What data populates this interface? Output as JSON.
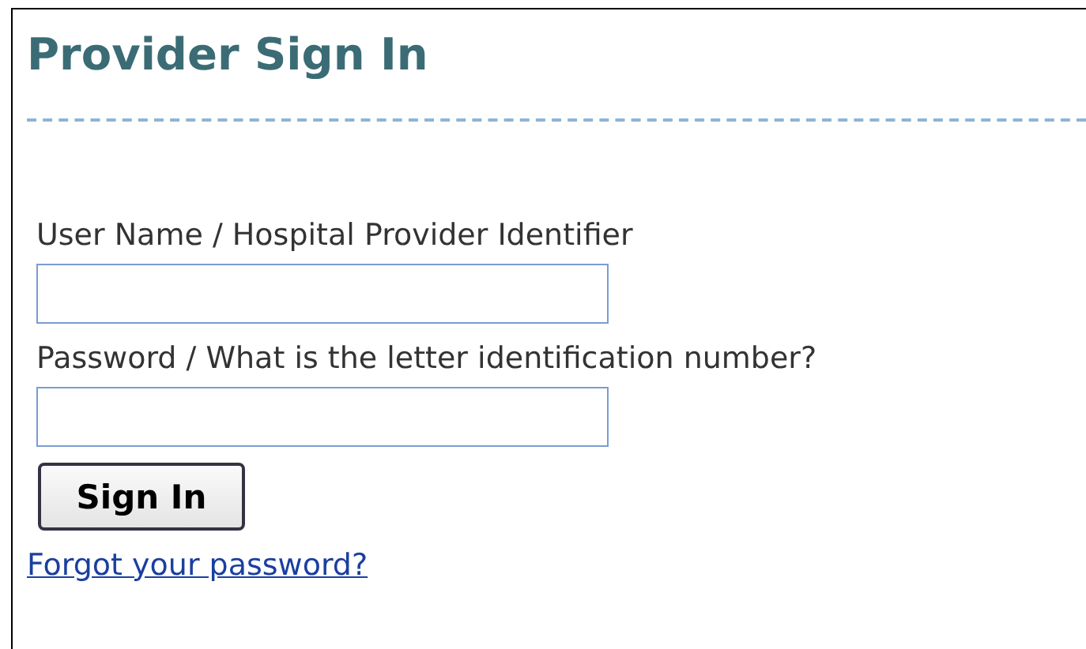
{
  "title": "Provider Sign In",
  "fields": [
    {
      "label": "User Name / Hospital Provider Identifier"
    },
    {
      "label": "Password / What is the letter identification number?"
    }
  ],
  "button": "Sign In",
  "link": "Forgot your password?"
}
